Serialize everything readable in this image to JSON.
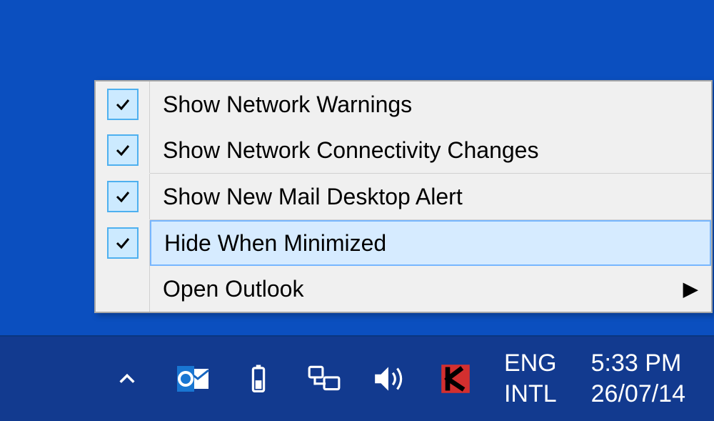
{
  "menu": {
    "items": [
      {
        "label": "Show Network Warnings",
        "checked": true
      },
      {
        "label": "Show Network Connectivity Changes",
        "checked": true
      },
      {
        "label": "Show New Mail Desktop Alert",
        "checked": true
      },
      {
        "label": "Hide When Minimized",
        "checked": true,
        "highlight": true
      },
      {
        "label": "Open Outlook",
        "checked": false,
        "submenu": true
      }
    ]
  },
  "taskbar": {
    "lang1": "ENG",
    "lang2": "INTL",
    "time": "5:33 PM",
    "date": "26/07/14",
    "icons": {
      "tray_chevron": "tray-chevron",
      "outlook": "outlook",
      "battery": "battery",
      "network": "network",
      "volume": "volume",
      "kaspersky": "kaspersky"
    }
  }
}
